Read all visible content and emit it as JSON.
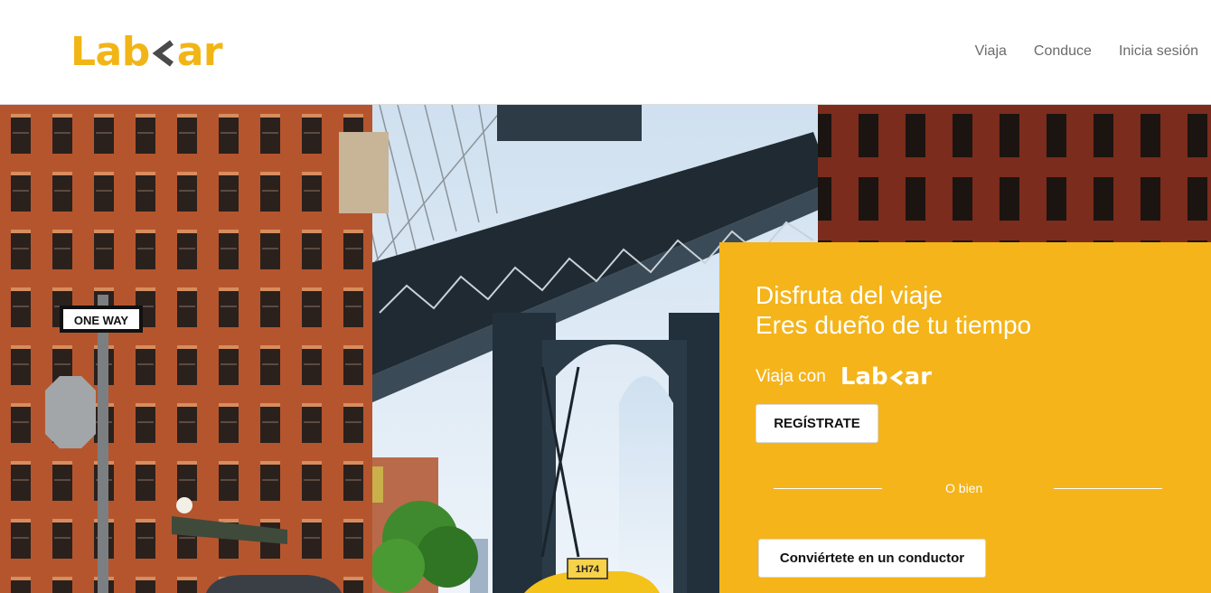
{
  "brand": {
    "name_left": "Lab",
    "name_right": "ar",
    "primary_color": "#f2b516",
    "accent_color": "#4a4a4a"
  },
  "nav": {
    "items": [
      "Viaja",
      "Conduce",
      "Inicia sesión"
    ]
  },
  "hero": {
    "image": "Manhattan Bridge with Empire State Building and yellow taxi between brick buildings",
    "sign_text": "ONE WAY",
    "taxi_number": "1H74"
  },
  "panel": {
    "background": "#f4b41a",
    "headline_line1": "Disfruta del viaje",
    "headline_line2": "Eres dueño de tu tiempo",
    "ride_with": "Viaja con",
    "register_button": "REGÍSTRATE",
    "or_text": "O bien",
    "driver_button": "Conviértete en un conductor"
  }
}
